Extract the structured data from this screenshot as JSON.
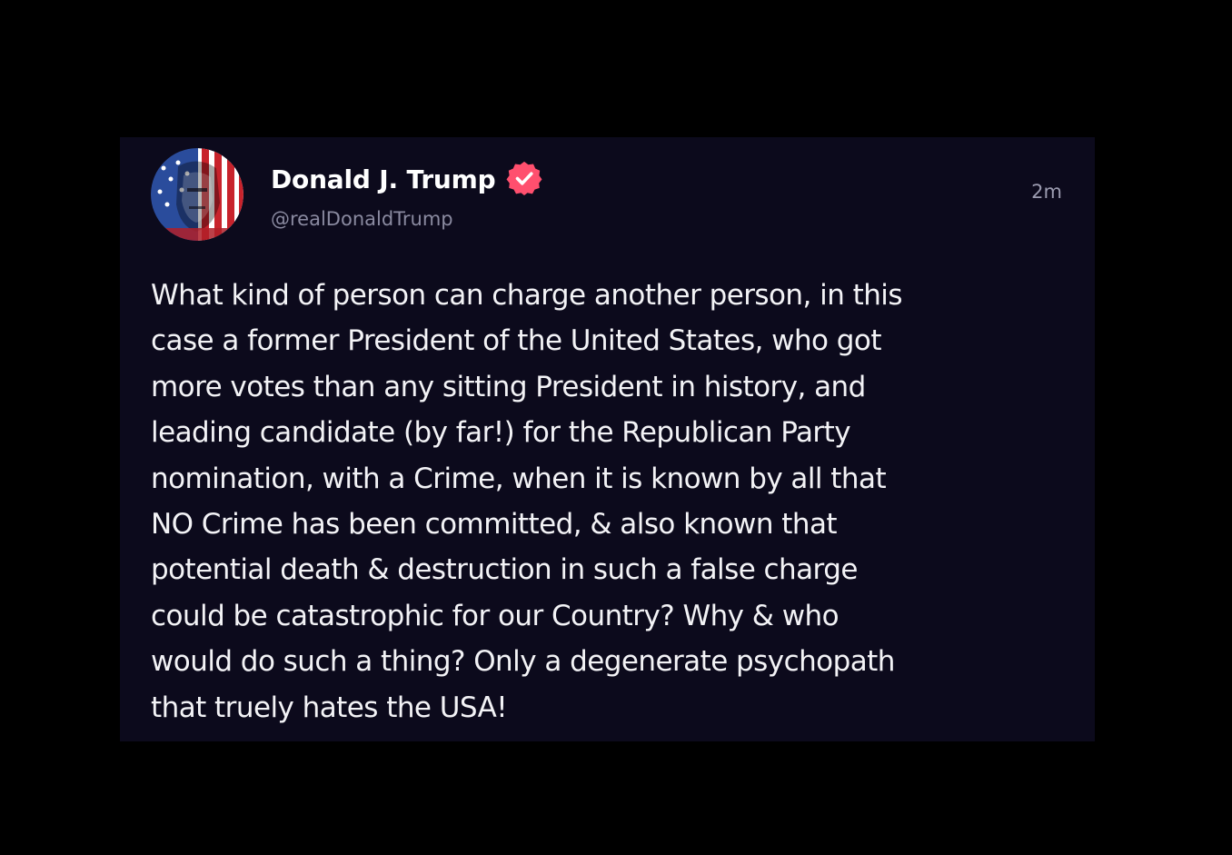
{
  "post": {
    "author": {
      "display_name": "Donald J. Trump",
      "handle": "@realDonaldTrump",
      "verified": true,
      "avatar_icon": "flag-portrait-avatar",
      "badge_icon": "verified-badge-icon",
      "badge_color": "#ff4f6e"
    },
    "timestamp": "2m",
    "body_lines": [
      "What kind of person can charge another person, in this",
      "case a former President of the United States, who got",
      "more votes than any sitting President in history, and",
      "leading candidate (by far!) for the Republican Party",
      "nomination, with a Crime, when it is known by all that",
      "NO Crime has been committed, & also known that",
      "potential death & destruction in such a false charge",
      "could be catastrophic for our Country? Why & who",
      "would do such a thing? Only a degenerate psychopath",
      "that truely hates the USA!"
    ]
  },
  "colors": {
    "page_background": "#000000",
    "card_background": "#0c0a1c",
    "text_primary": "#ffffff",
    "text_secondary": "#8a8aa0"
  }
}
